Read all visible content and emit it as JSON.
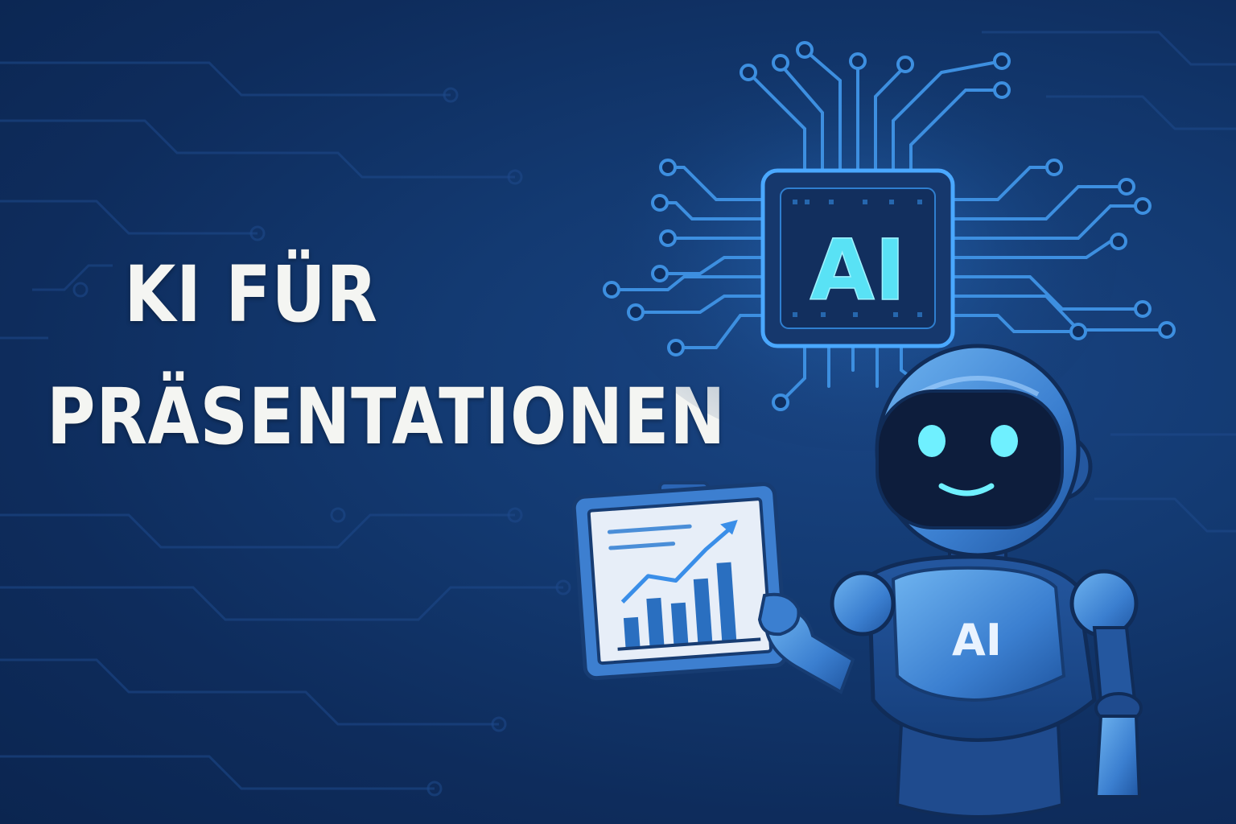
{
  "headline": {
    "line1": "KI FÜR",
    "line2": "PRÄSENTATIONEN"
  },
  "chip": {
    "label": "AI",
    "glow_color": "#3fd6f0"
  },
  "robot": {
    "torso_label": "AI",
    "eye_color": "#6ff0ff"
  },
  "clipboard_chart": {
    "bar_color": "#2a6fc0",
    "trend": "rising"
  },
  "colors": {
    "background": "#123770",
    "circuit_line": "#2a5fa8",
    "headline_text": "#f4f5f2"
  }
}
